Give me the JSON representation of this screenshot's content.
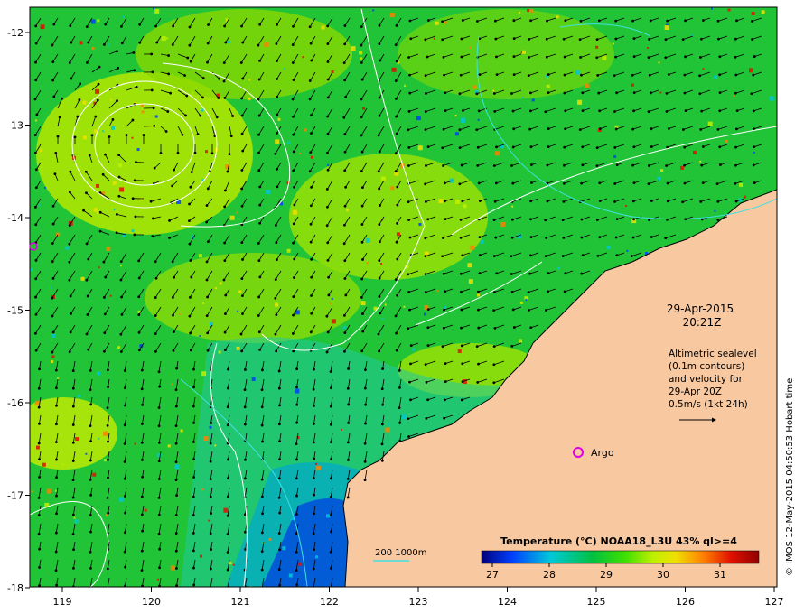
{
  "map": {
    "title_date": "29-Apr-2015",
    "title_time": "20:21Z",
    "info_lines": [
      "Altimetric sealevel",
      "(0.1m contours)",
      "and velocity for",
      "29-Apr 20Z",
      "0.5m/s (1kt 24h)"
    ],
    "argo_label": "Argo",
    "scale_label": "200  1000m",
    "credit": "© IMOS 12-May-2015 04:50:53 Hobart time",
    "x_ticks": [
      "119",
      "120",
      "121",
      "122",
      "123",
      "124",
      "125",
      "126",
      "127"
    ],
    "y_ticks": [
      "-12",
      "-13",
      "-14",
      "-15",
      "-16",
      "-17",
      "-18"
    ]
  },
  "colorbar": {
    "title": "Temperature (°C) NOAA18_L3U 43% ql>=4",
    "ticks": [
      "27",
      "28",
      "29",
      "30",
      "31"
    ],
    "colors": [
      "#00007a",
      "#0040ff",
      "#00c8d8",
      "#00c040",
      "#40e000",
      "#c0f000",
      "#f0e000",
      "#ff8000",
      "#e01000",
      "#900000"
    ]
  },
  "colors": {
    "land": "#f8c8a0",
    "sea_main": "#22c437",
    "contour": "#ffffff",
    "shelf_contour": "#40e0e0",
    "argo": "#e000e0"
  }
}
